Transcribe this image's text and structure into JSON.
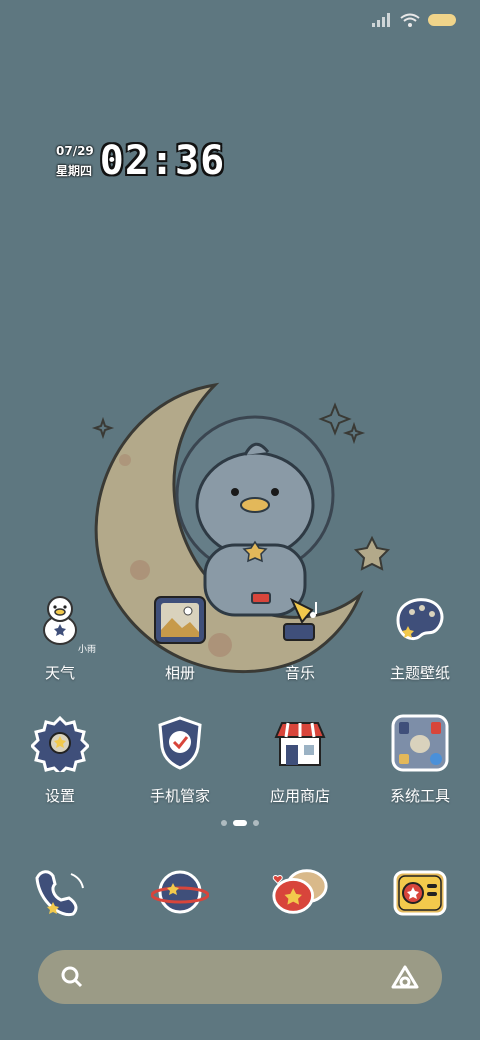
{
  "clock": {
    "date": "07/29",
    "weekday": "星期四",
    "time": "02:36"
  },
  "widget": {
    "weather_hint": "小雨"
  },
  "apps_row1": [
    {
      "label": "天气",
      "icon": "duck-weather-icon"
    },
    {
      "label": "相册",
      "icon": "photo-album-icon"
    },
    {
      "label": "音乐",
      "icon": "music-gramophone-icon"
    },
    {
      "label": "主题壁纸",
      "icon": "theme-palette-icon"
    }
  ],
  "apps_row2": [
    {
      "label": "设置",
      "icon": "gear-icon"
    },
    {
      "label": "手机管家",
      "icon": "shield-check-icon"
    },
    {
      "label": "应用商店",
      "icon": "store-icon"
    },
    {
      "label": "系统工具",
      "icon": "tools-folder-icon"
    }
  ],
  "dock": [
    {
      "icon": "phone-icon"
    },
    {
      "icon": "planet-browser-icon"
    },
    {
      "icon": "chat-bubbles-icon"
    },
    {
      "icon": "camera-icon"
    }
  ],
  "colors": {
    "background": "#5e7780",
    "moon": "#b3a98a",
    "icon_navy": "#3f4f7a",
    "accent_red": "#d8453b",
    "accent_yellow": "#f2c94c",
    "search_bar": "#9b9b86"
  }
}
